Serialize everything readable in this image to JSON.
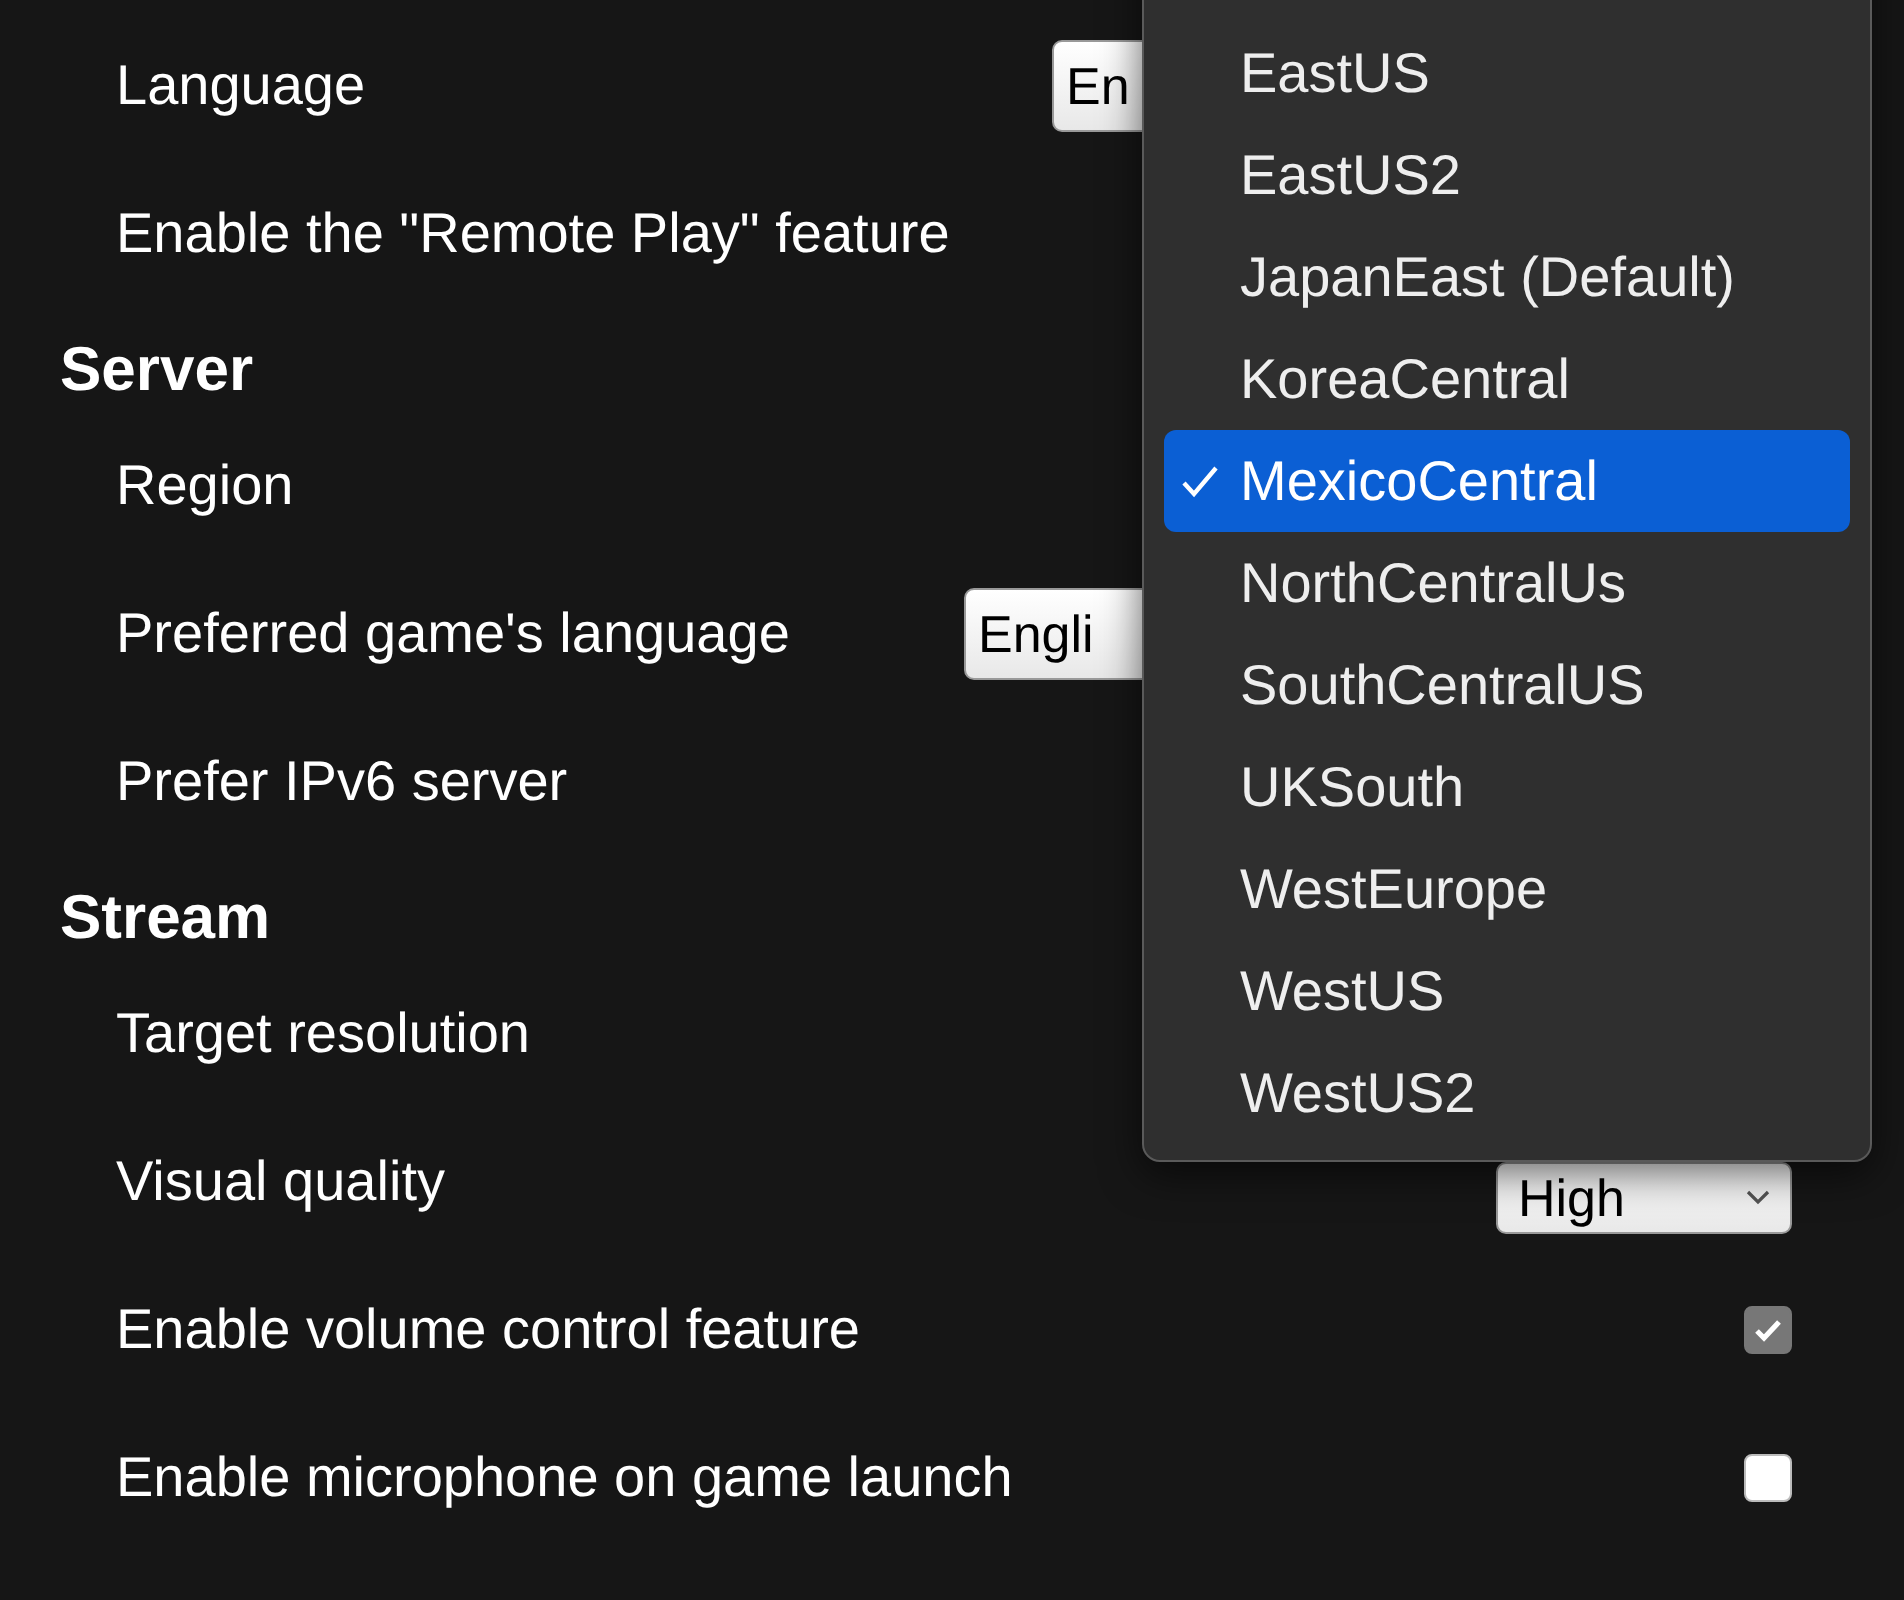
{
  "sections": [
    {
      "items": [
        {
          "label": "Language",
          "control": {
            "kind": "select",
            "value": "En"
          }
        },
        {
          "label": "Enable the \"Remote Play\" feature"
        }
      ]
    },
    {
      "title": "Server",
      "items": [
        {
          "label": "Region"
        },
        {
          "label": "Preferred game's language",
          "control": {
            "kind": "select",
            "value": "Engli"
          }
        },
        {
          "label": "Prefer IPv6 server"
        }
      ]
    },
    {
      "title": "Stream",
      "items": [
        {
          "label": "Target resolution"
        },
        {
          "label": "Visual quality",
          "control": {
            "kind": "select",
            "value": "High"
          }
        },
        {
          "label": "Enable volume control feature",
          "control": {
            "kind": "checkbox",
            "checked": true
          }
        },
        {
          "label": "Enable microphone on game launch",
          "control": {
            "kind": "checkbox",
            "checked": false
          }
        }
      ]
    }
  ],
  "dropdown": {
    "items": [
      {
        "label": "EastUS",
        "selected": false
      },
      {
        "label": "EastUS2",
        "selected": false
      },
      {
        "label": "JapanEast (Default)",
        "selected": false
      },
      {
        "label": "KoreaCentral",
        "selected": false
      },
      {
        "label": "MexicoCentral",
        "selected": true
      },
      {
        "label": "NorthCentralUs",
        "selected": false
      },
      {
        "label": "SouthCentralUS",
        "selected": false
      },
      {
        "label": "UKSouth",
        "selected": false
      },
      {
        "label": "WestEurope",
        "selected": false
      },
      {
        "label": "WestUS",
        "selected": false
      },
      {
        "label": "WestUS2",
        "selected": false
      }
    ]
  }
}
